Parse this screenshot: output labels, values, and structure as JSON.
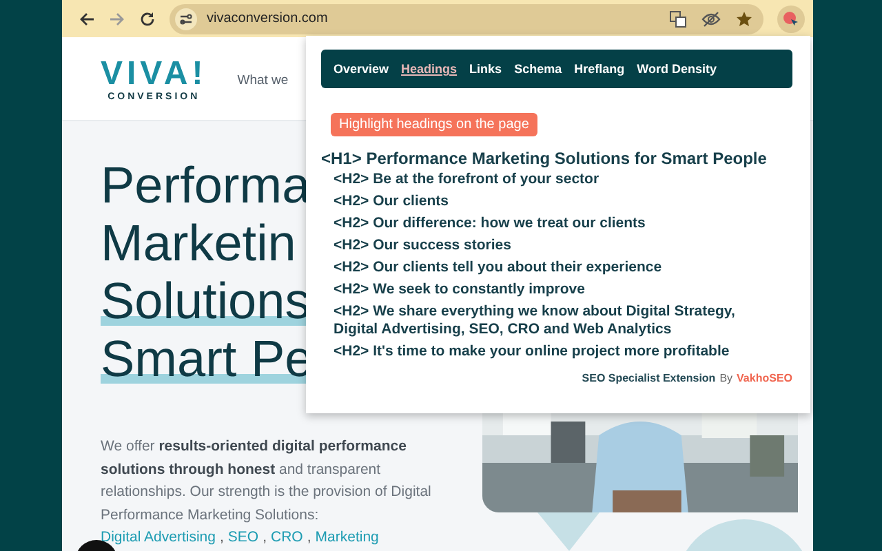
{
  "browser": {
    "url": "vivaconversion.com"
  },
  "site": {
    "logo_top": "VIVA!",
    "logo_bottom": "CONVERSION",
    "nav_item": "What we",
    "hero_title_lines": [
      {
        "text": "Performa",
        "highlight": false
      },
      {
        "text": "Marketin",
        "highlight": false
      },
      {
        "text": "Solutions",
        "highlight": true
      },
      {
        "text": "Smart Pe",
        "highlight": true
      }
    ],
    "intro": "We offer **results-oriented digital performance solutions through honest** and transparent relationships. Our strength is the provision of Digital Performance Marketing Solutions:",
    "service_links": [
      "Digital Advertising",
      "SEO",
      "CRO",
      "Marketing"
    ],
    "link_separator": ","
  },
  "popup": {
    "tabs": [
      {
        "label": "Overview",
        "selected": false
      },
      {
        "label": "Headings",
        "selected": true
      },
      {
        "label": "Links",
        "selected": false
      },
      {
        "label": "Schema",
        "selected": false
      },
      {
        "label": "Hreflang",
        "selected": false
      },
      {
        "label": "Word Density",
        "selected": false
      }
    ],
    "highlight_button": "Highlight headings on the page",
    "headings": [
      {
        "tag": "<H1>",
        "text": "Performance Marketing Solutions for Smart People",
        "children": [
          {
            "tag": "<H2>",
            "text": "Be at the forefront of your sector"
          },
          {
            "tag": "<H2>",
            "text": "Our clients"
          },
          {
            "tag": "<H2>",
            "text": "Our difference: how we treat our clients"
          },
          {
            "tag": "<H2>",
            "text": "Our success stories"
          },
          {
            "tag": "<H2>",
            "text": "Our clients tell you about their experience"
          },
          {
            "tag": "<H2>",
            "text": "We seek to constantly improve"
          },
          {
            "tag": "<H2>",
            "text": "We share everything we know about Digital Strategy, Digital Advertising, SEO, CRO and Web Analytics"
          },
          {
            "tag": "<H2>",
            "text": "It's time to make your online project more profitable"
          }
        ]
      }
    ],
    "footer": {
      "name": "SEO Specialist Extension",
      "by": "By",
      "author": "VakhoSEO"
    }
  }
}
